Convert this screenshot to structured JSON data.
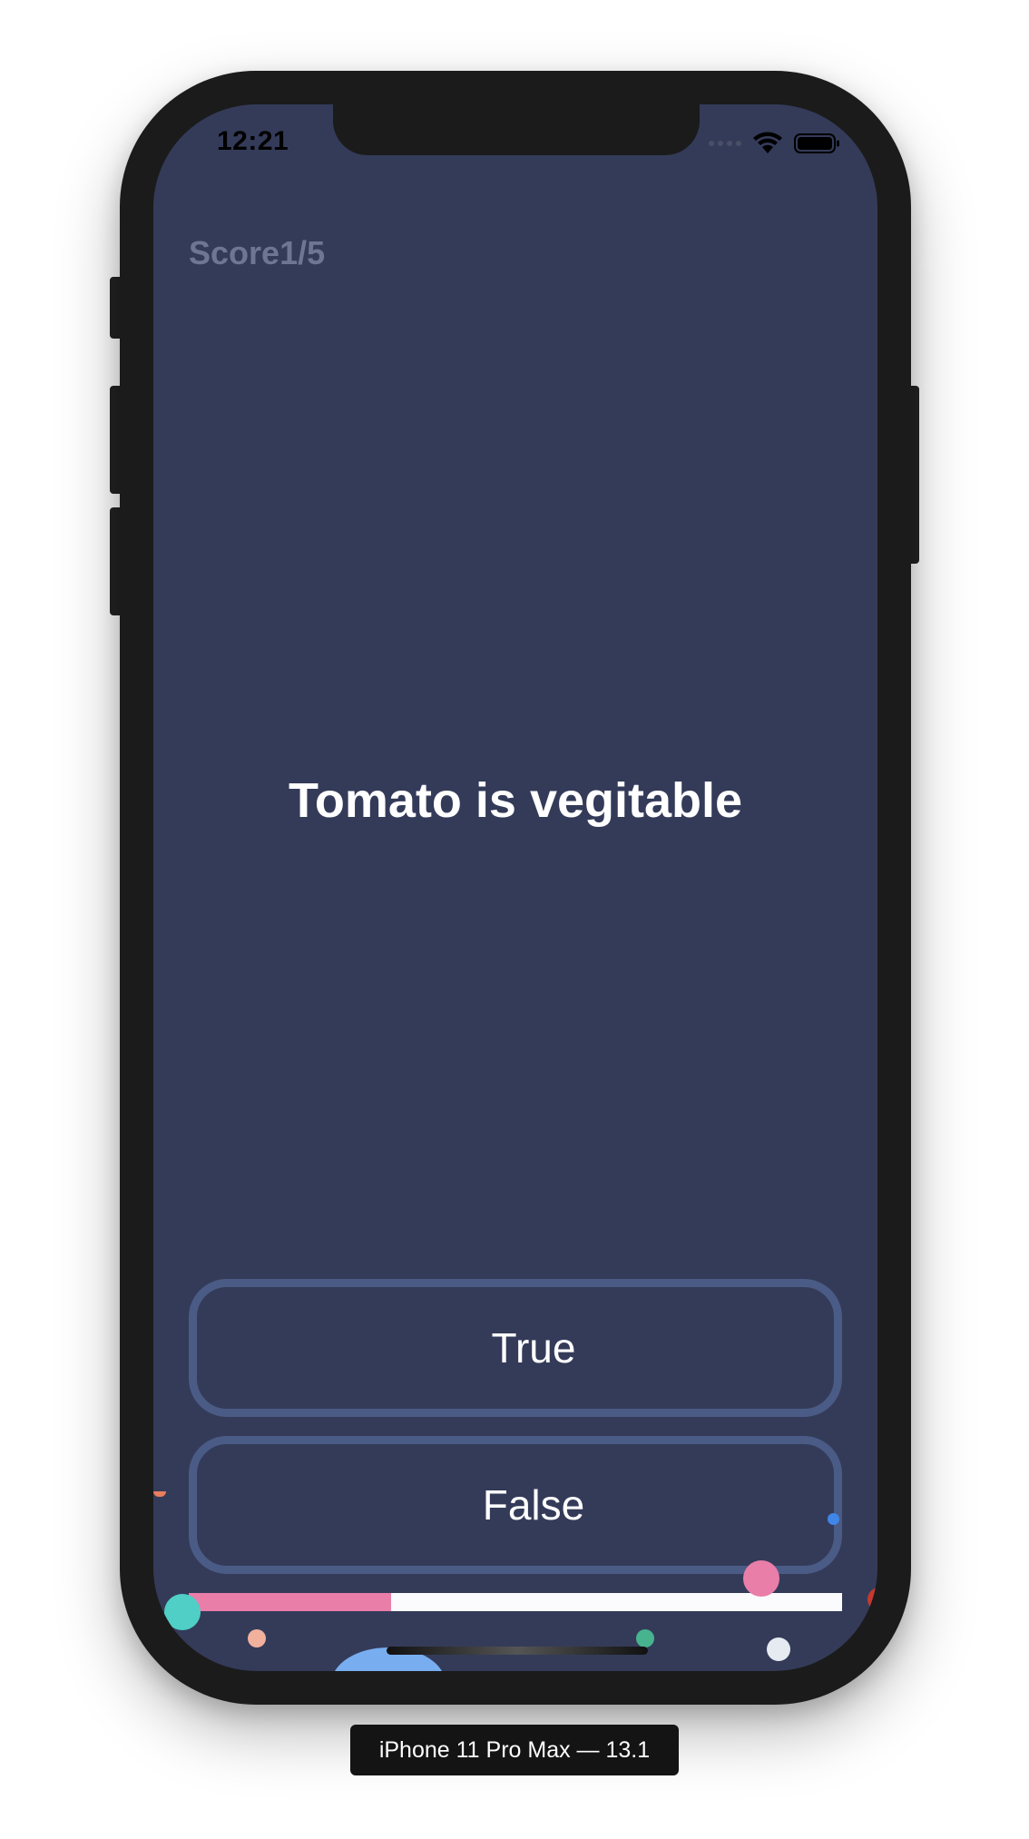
{
  "status_bar": {
    "time": "12:21",
    "icons": [
      "signal-dots-icon",
      "wifi-icon",
      "battery-icon"
    ]
  },
  "quiz": {
    "score_label": "Score",
    "score_value": "1/5",
    "question": "Tomato is vegitable",
    "answers": {
      "true_label": "True",
      "false_label": "False"
    },
    "progress_fraction": 0.31
  },
  "colors": {
    "background": "#343b59",
    "button_border": "#4a5b86",
    "progress_fill": "#e97ea9",
    "progress_track": "#fbfbfd",
    "score_text": "#6f7693"
  },
  "device_label": "iPhone 11 Pro Max — 13.1"
}
